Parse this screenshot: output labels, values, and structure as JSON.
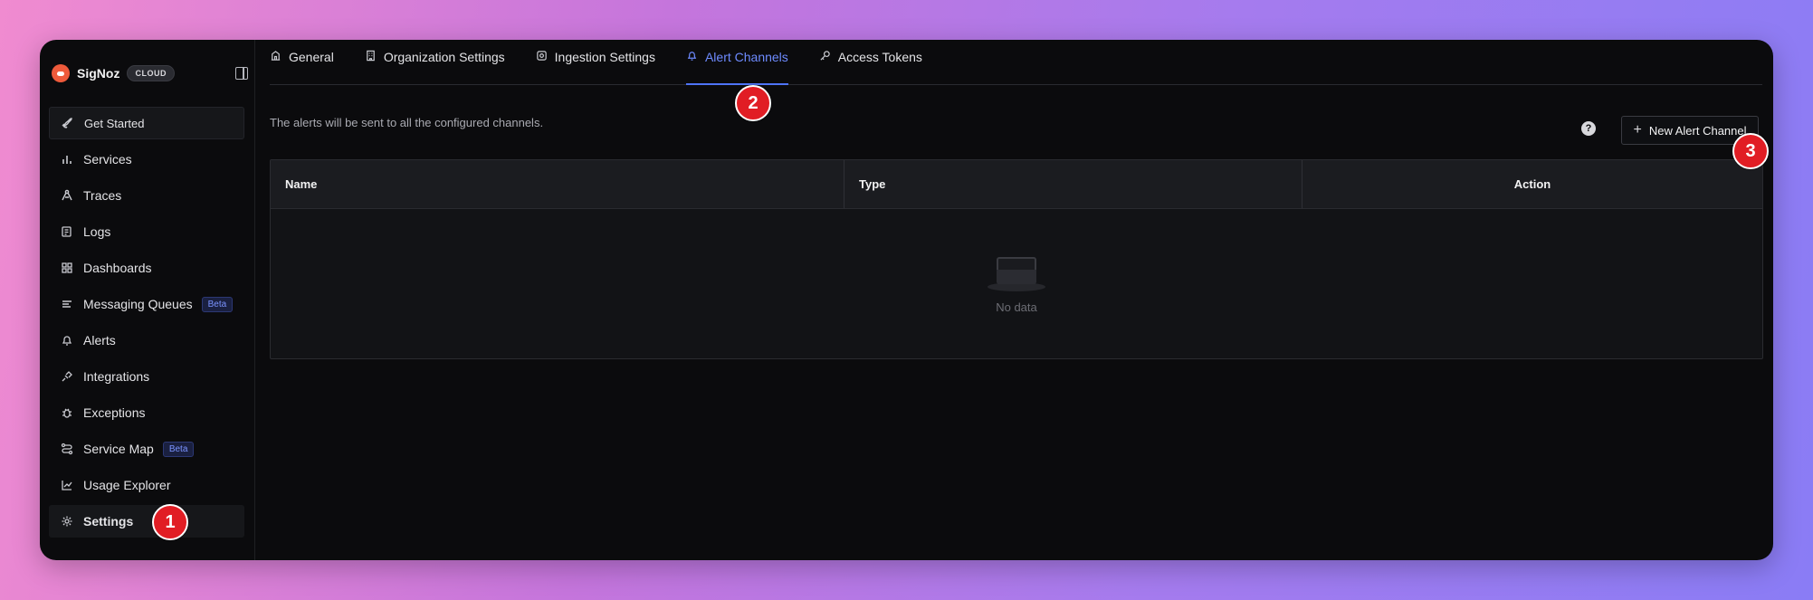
{
  "brand": {
    "name": "SigNoz",
    "badge": "CLOUD"
  },
  "sidebar": {
    "items": [
      {
        "label": "Get Started",
        "icon": "rocket-icon"
      },
      {
        "label": "Services",
        "icon": "bar-chart-icon"
      },
      {
        "label": "Traces",
        "icon": "route-icon"
      },
      {
        "label": "Logs",
        "icon": "scroll-icon"
      },
      {
        "label": "Dashboards",
        "icon": "grid-icon"
      },
      {
        "label": "Messaging Queues",
        "icon": "list-icon",
        "badge": "Beta"
      },
      {
        "label": "Alerts",
        "icon": "bell-icon"
      },
      {
        "label": "Integrations",
        "icon": "plug-icon"
      },
      {
        "label": "Exceptions",
        "icon": "bug-icon"
      },
      {
        "label": "Service Map",
        "icon": "map-icon",
        "badge": "Beta"
      },
      {
        "label": "Usage Explorer",
        "icon": "line-chart-icon"
      },
      {
        "label": "Settings",
        "icon": "gear-icon",
        "active": true
      }
    ]
  },
  "tabs": [
    {
      "label": "General",
      "icon": "building-icon"
    },
    {
      "label": "Organization Settings",
      "icon": "office-icon"
    },
    {
      "label": "Ingestion Settings",
      "icon": "cog-icon"
    },
    {
      "label": "Alert Channels",
      "icon": "bell-icon",
      "active": true
    },
    {
      "label": "Access Tokens",
      "icon": "key-icon"
    }
  ],
  "main": {
    "description": "The alerts will be sent to all the configured channels.",
    "help": "?",
    "new_button": "New Alert Channel",
    "table": {
      "columns": [
        "Name",
        "Type",
        "Action"
      ],
      "empty_text": "No data"
    }
  },
  "markers": [
    "1",
    "2",
    "3"
  ],
  "colors": {
    "accent": "#4e74f8",
    "marker": "#e11d24",
    "logo": "#ee5a3b"
  }
}
